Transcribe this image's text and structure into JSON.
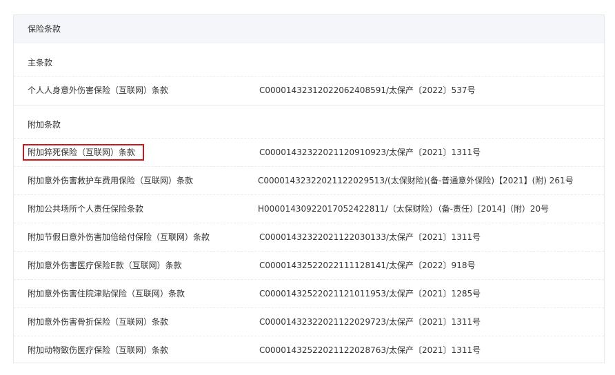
{
  "panel": {
    "header": "保险条款"
  },
  "main_clause": {
    "title": "主条款",
    "items": [
      {
        "name": "个人人身意外伤害保险（互联网）条款",
        "code": "C00001432312022062408591/太保产〔2022〕537号"
      }
    ]
  },
  "rider_clause": {
    "title": "附加条款",
    "items": [
      {
        "name": "附加猝死保险（互联网）条款",
        "code": "C00001432322021120910923/太保产〔2021〕1311号",
        "highlighted": true
      },
      {
        "name": "附加意外伤害救护车费用保险（互联网）条款",
        "code": "C00001432322021122029513/(太保财险)(备-普通意外保险)【2021】(附) 261号"
      },
      {
        "name": "附加公共场所个人责任保险条款",
        "code": "H00001430922017052422811/（太保财险）（备-责任）[2014]（附）20号"
      },
      {
        "name": "附加节假日意外伤害加倍给付保险（互联网）条款",
        "code": "C00001432322021122030133/太保产〔2021〕1311号"
      },
      {
        "name": "附加意外伤害医疗保险E款（互联网）条款",
        "code": "C00001432522022111128141/太保产〔2022〕918号"
      },
      {
        "name": "附加意外伤害住院津贴保险（互联网）条款",
        "code": "C00001432522021121011953/太保产〔2021〕1285号"
      },
      {
        "name": "附加意外伤害骨折保险（互联网）条款",
        "code": "C00001432322021122029723/太保产〔2021〕1311号"
      },
      {
        "name": "附加动物致伤医疗保险（互联网）条款",
        "code": "C00001432522021122028763/太保产〔2021〕1311号"
      }
    ]
  },
  "colors": {
    "highlight_border": "#d0141c",
    "header_bg": "#f4f6f9",
    "border": "#e4e9f0",
    "text": "#333333"
  }
}
